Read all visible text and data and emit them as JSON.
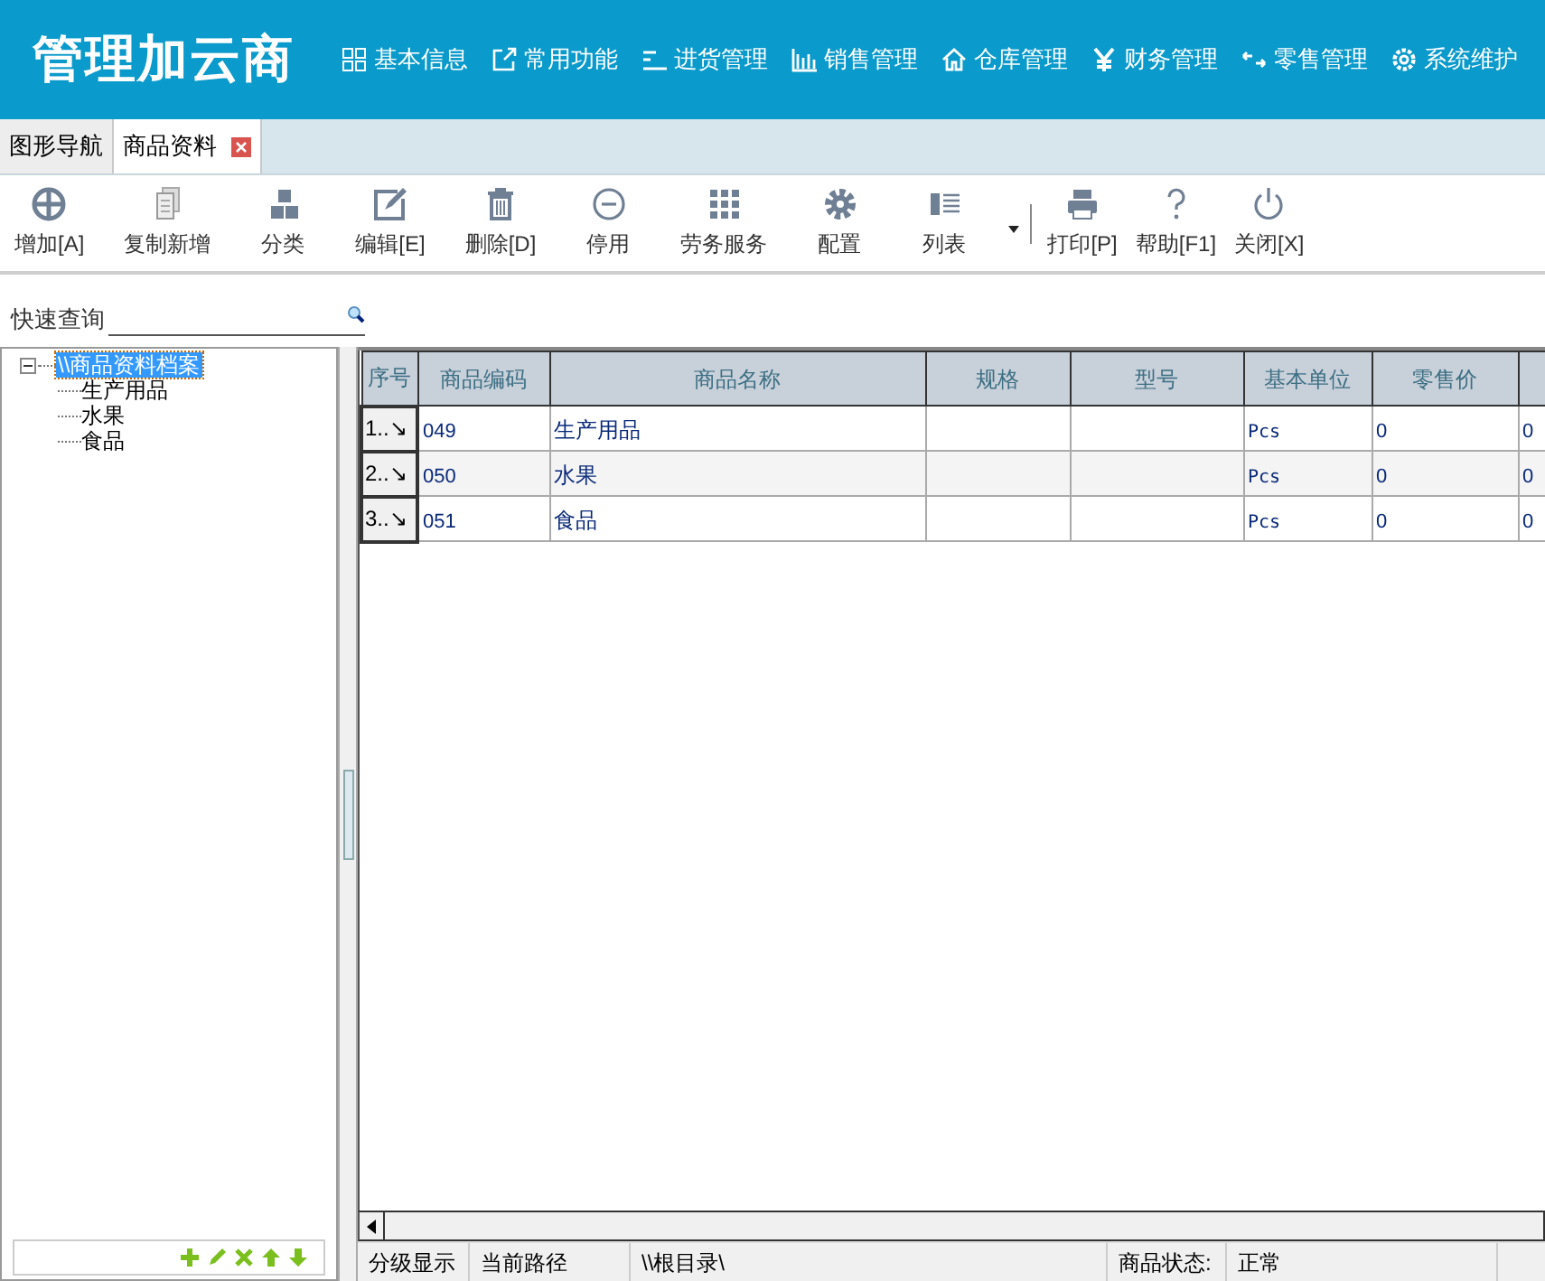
{
  "header": {
    "logo": "管理加云商",
    "nav": [
      {
        "label": "基本信息"
      },
      {
        "label": "常用功能"
      },
      {
        "label": "进货管理"
      },
      {
        "label": "销售管理"
      },
      {
        "label": "仓库管理"
      },
      {
        "label": "财务管理"
      },
      {
        "label": "零售管理"
      },
      {
        "label": "系统维护"
      }
    ]
  },
  "tabs": [
    {
      "label": "图形导航",
      "selected": false,
      "closable": false
    },
    {
      "label": "商品资料",
      "selected": true,
      "closable": true
    }
  ],
  "toolbar": [
    {
      "label": "增加[A]"
    },
    {
      "label": "复制新增"
    },
    {
      "label": "分类"
    },
    {
      "label": "编辑[E]"
    },
    {
      "label": "删除[D]"
    },
    {
      "label": "停用"
    },
    {
      "label": "劳务服务"
    },
    {
      "label": "配置"
    },
    {
      "label": "列表",
      "dropdown": true
    },
    {
      "label": "打印[P]",
      "separator_before": true
    },
    {
      "label": "帮助[F1]"
    },
    {
      "label": "关闭[X]"
    }
  ],
  "quick_search": {
    "label": "快速查询"
  },
  "tree": {
    "label": "\\\\商品资料档案",
    "selected": true,
    "expanded": true,
    "children": [
      {
        "label": "生产用品",
        "selected": false
      },
      {
        "label": "水果",
        "selected": false
      },
      {
        "label": "食品",
        "selected": false
      }
    ]
  },
  "table": {
    "columns": [
      "序号",
      "商品编码",
      "商品名称",
      "规格",
      "型号",
      "基本单位",
      "零售价"
    ],
    "rows": [
      {
        "cells": [
          "1..↘",
          "049",
          "生产用品",
          "",
          "",
          "Pcs",
          "0",
          "0"
        ],
        "selected": false
      },
      {
        "cells": [
          "2..↘",
          "050",
          "水果",
          "",
          "",
          "Pcs",
          "0",
          "0"
        ],
        "selected": false
      },
      {
        "cells": [
          "3..↘",
          "051",
          "食品",
          "",
          "",
          "Pcs",
          "0",
          "0"
        ],
        "selected": false
      }
    ]
  },
  "status_bar": [
    "分级显示",
    "当前路径",
    "\\\\根目录\\",
    "商品状态:",
    "正常"
  ]
}
